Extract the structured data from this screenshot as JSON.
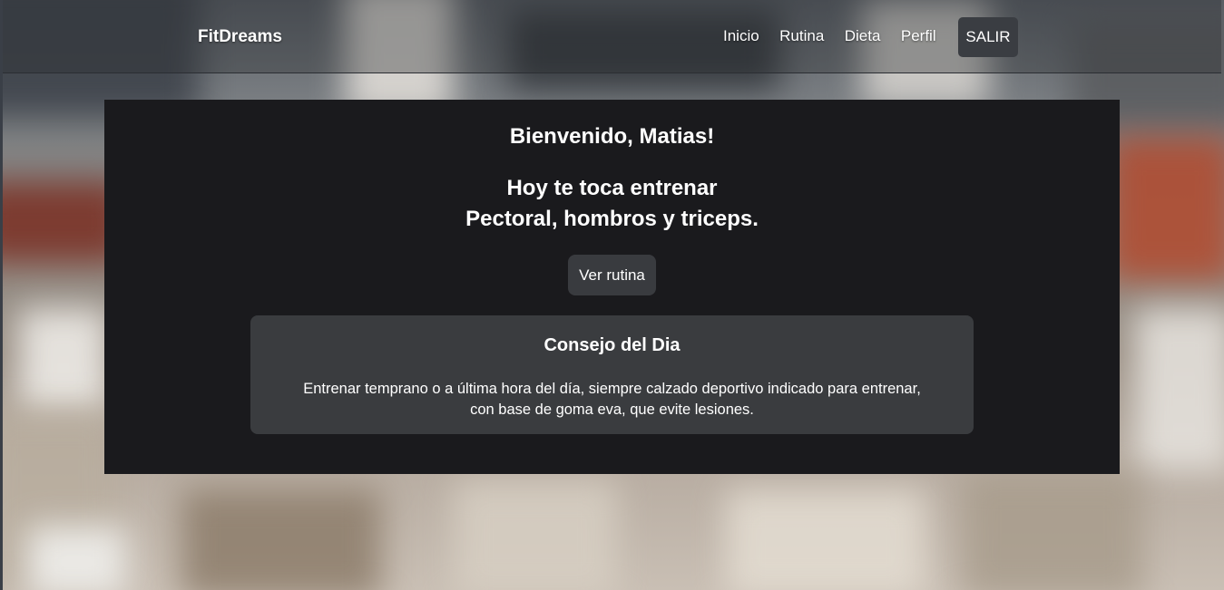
{
  "navbar": {
    "brand": "FitDreams",
    "links": [
      {
        "label": "Inicio"
      },
      {
        "label": "Rutina"
      },
      {
        "label": "Dieta"
      },
      {
        "label": "Perfil"
      }
    ],
    "logout_label": "SALIR"
  },
  "main": {
    "welcome": "Bienvenido, Matias!",
    "today_line1": "Hoy te toca entrenar",
    "today_line2": "Pectoral, hombros y triceps.",
    "routine_button": "Ver rutina",
    "tip": {
      "title": "Consejo del Dia",
      "text_line1": "Entrenar temprano o a última hora del día, siempre calzado deportivo indicado para entrenar,",
      "text_line2": "con base de goma eva, que evite lesiones."
    }
  },
  "colors": {
    "panel_bg": "#1a1a1d",
    "card_bg": "#3a3c3f",
    "button_bg": "#393b3f",
    "text": "#ffffff"
  }
}
